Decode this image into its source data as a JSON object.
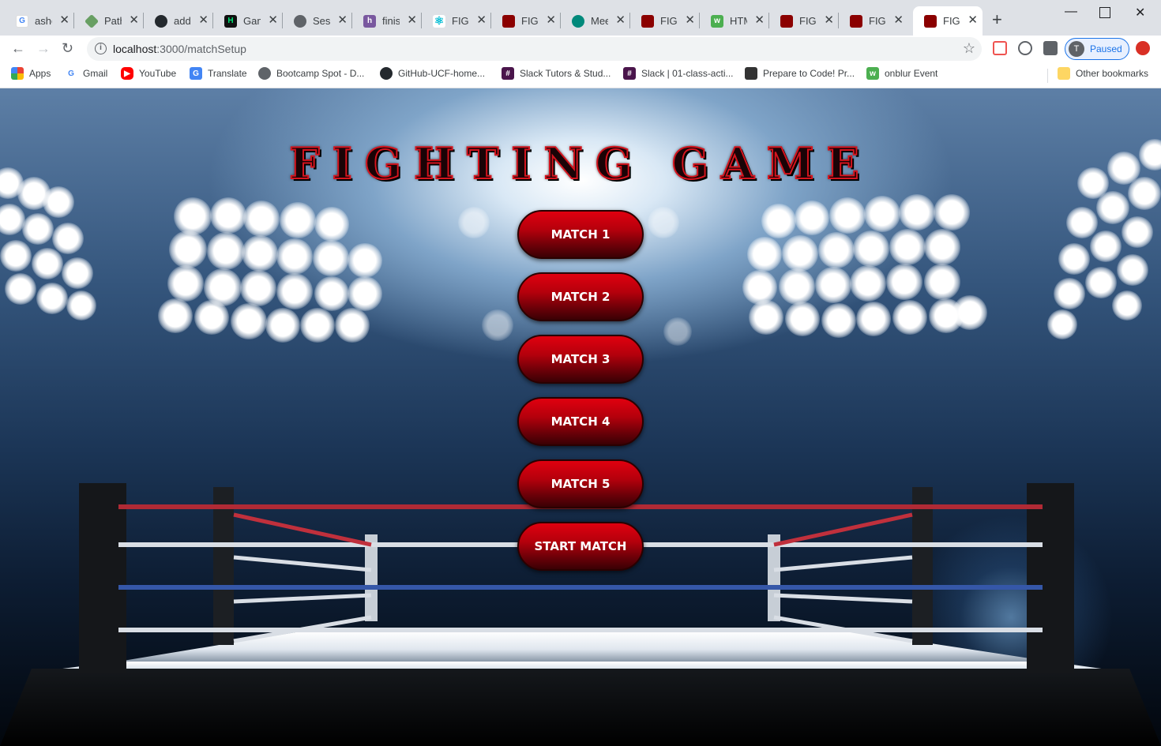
{
  "browser": {
    "tabs": [
      {
        "title": "ashe",
        "icon": "google-icon"
      },
      {
        "title": "Path",
        "icon": "nodejs-icon"
      },
      {
        "title": "add",
        "icon": "github-icon"
      },
      {
        "title": "Gam",
        "icon": "hackernoon-icon"
      },
      {
        "title": "Sess",
        "icon": "globe-icon"
      },
      {
        "title": "finis",
        "icon": "heroku-icon"
      },
      {
        "title": "FIGH",
        "icon": "react-icon"
      },
      {
        "title": "FIGH",
        "icon": "game-icon"
      },
      {
        "title": "Mee",
        "icon": "meet-icon"
      },
      {
        "title": "FIGH",
        "icon": "game-icon"
      },
      {
        "title": "HTM",
        "icon": "w3schools-icon"
      },
      {
        "title": "FIGH",
        "icon": "game-icon"
      },
      {
        "title": "FIGH",
        "icon": "game-icon"
      },
      {
        "title": "FIGH",
        "icon": "game-icon",
        "active": true
      }
    ],
    "url_host": "localhost",
    "url_path": ":3000/matchSetup",
    "profile_initial": "T",
    "profile_status": "Paused",
    "bookmarks": [
      {
        "label": "Apps",
        "icon": "apps-grid-icon"
      },
      {
        "label": "Gmail",
        "icon": "google-icon"
      },
      {
        "label": "YouTube",
        "icon": "youtube-icon"
      },
      {
        "label": "Translate",
        "icon": "translate-icon"
      },
      {
        "label": "Bootcamp Spot - D...",
        "icon": "globe-icon"
      },
      {
        "label": "GitHub-UCF-home...",
        "icon": "github-icon"
      },
      {
        "label": "Slack Tutors & Stud...",
        "icon": "slack-icon"
      },
      {
        "label": "Slack | 01-class-acti...",
        "icon": "slack-icon"
      },
      {
        "label": "Prepare to Code! Pr...",
        "icon": "book-icon"
      },
      {
        "label": "onblur Event",
        "icon": "w3schools-icon"
      }
    ],
    "other_bookmarks": "Other bookmarks"
  },
  "page": {
    "title": "FIGHTING GAME",
    "buttons": {
      "match1": "MATCH 1",
      "match2": "MATCH 2",
      "match3": "MATCH 3",
      "match4": "MATCH 4",
      "match5": "MATCH 5",
      "start": "START MATCH"
    }
  },
  "colors": {
    "accent_red": "#d4141e",
    "button_dark_red": "#6a0008",
    "chrome_bg": "#dee1e6",
    "profile_blue": "#1a73e8"
  }
}
